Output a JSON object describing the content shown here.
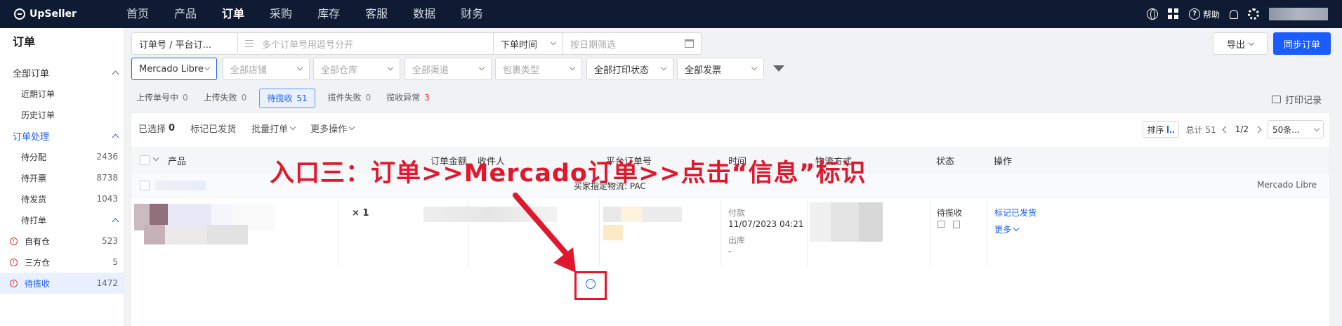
{
  "topbar": {
    "logo": "UpSeller",
    "nav": [
      "首页",
      "产品",
      "订单",
      "采购",
      "库存",
      "客服",
      "数据",
      "财务"
    ],
    "active_index": 2,
    "help_label": "帮助"
  },
  "sidebar": {
    "title": "订单",
    "groups": [
      {
        "label": "全部订单",
        "items": [
          {
            "label": "近期订单",
            "count": ""
          },
          {
            "label": "历史订单",
            "count": ""
          }
        ]
      },
      {
        "label": "订单处理",
        "items": [
          {
            "label": "待分配",
            "count": "2436"
          },
          {
            "label": "待开票",
            "count": "8738"
          },
          {
            "label": "待发货",
            "count": "1043"
          }
        ]
      }
    ],
    "subgroup": "待打单",
    "subgroup_items": [
      {
        "label": "自有仓",
        "count": "523"
      },
      {
        "label": "三方仓",
        "count": "5"
      },
      {
        "label": "待揽收",
        "count": "1472"
      }
    ]
  },
  "filters": {
    "order_type": "订单号 / 平台订...",
    "order_search_placeholder": "多个订单号用逗号分开",
    "time_type": "下单时间",
    "date_placeholder": "按日期筛选",
    "export": "导出",
    "sync": "同步订单",
    "platform": "Mercado Libre",
    "store": "全部店铺",
    "warehouse": "全部仓库",
    "channel": "全部渠道",
    "package_type": "包裹类型",
    "print_status": "全部打印状态",
    "invoice": "全部发票"
  },
  "tabs": [
    {
      "label": "上传单号中",
      "count": "0",
      "red": false,
      "active": false
    },
    {
      "label": "上传失败",
      "count": "0",
      "red": false,
      "active": false
    },
    {
      "label": "待揽收",
      "count": "51",
      "red": false,
      "active": true
    },
    {
      "label": "揽件失败",
      "count": "0",
      "red": false,
      "active": false
    },
    {
      "label": "揽收异常",
      "count": "3",
      "red": true,
      "active": false
    }
  ],
  "print_log": "打印记录",
  "toolbar": {
    "selected_label": "已选择",
    "selected_count": "0",
    "mark_shipped": "标记已发货",
    "batch_print": "批量打单",
    "more_actions": "更多操作",
    "sort": "排序",
    "total": "总计 51",
    "page": "1/2",
    "page_size": "50条..."
  },
  "table": {
    "headers": [
      "产品",
      "订单金额",
      "收件人",
      "平台订单号",
      "时间",
      "物流方式",
      "状态",
      "操作"
    ],
    "group_text": "买家指定物流: PAC",
    "group_platform": "Mercado Libre",
    "row": {
      "qty": "× 1",
      "paid_label": "付款",
      "paid_time": "11/07/2023 04:21",
      "out_label": "出库",
      "out_value": "-",
      "status": "待揽收",
      "action_mark": "标记已发货",
      "action_more": "更多"
    }
  },
  "annotation": "入口三：订单>>Mercado订单>>点击“信息”标识",
  "colors": {
    "accent": "#1a5cff",
    "annotation": "#e0182d",
    "topbar": "#0f1a33"
  }
}
